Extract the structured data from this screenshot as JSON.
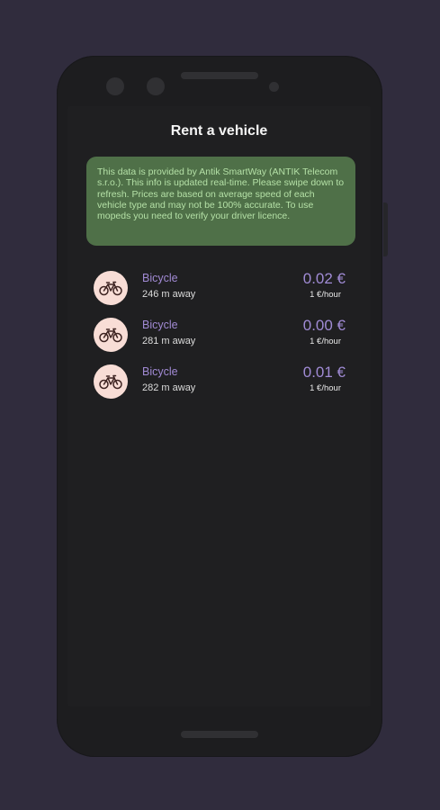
{
  "header": {
    "title": "Rent a vehicle"
  },
  "notice": {
    "text": "This data is provided by Antik SmartWay (ANTIK Telecom s.r.o.). This info is updated real-time. Please swipe down to refresh. Prices are based on average speed of each vehicle type and may not be 100% accurate. To use mopeds you need to verify your driver licence."
  },
  "vehicles": [
    {
      "icon": "bicycle-icon",
      "name": "Bicycle",
      "distance": "246 m away",
      "price": "0.02 €",
      "rate": "1 €/hour"
    },
    {
      "icon": "bicycle-icon",
      "name": "Bicycle",
      "distance": "281 m away",
      "price": "0.00 €",
      "rate": "1 €/hour"
    },
    {
      "icon": "bicycle-icon",
      "name": "Bicycle",
      "distance": "282 m away",
      "price": "0.01 €",
      "rate": "1 €/hour"
    }
  ],
  "colors": {
    "background": "#302c3d",
    "screen": "#1f1f21",
    "notice_bg": "#4f7048",
    "notice_text": "#b4e0a6",
    "accent": "#a18ad4",
    "icon_bg": "#f8ddd6"
  }
}
